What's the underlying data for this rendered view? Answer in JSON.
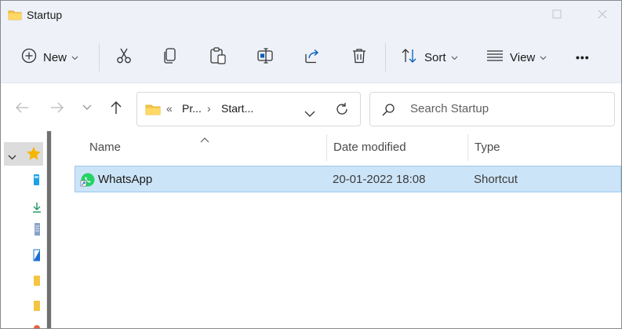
{
  "window": {
    "title": "Startup"
  },
  "toolbar": {
    "new_label": "New",
    "sort_label": "Sort",
    "view_label": "View",
    "more_label": "•••"
  },
  "address": {
    "overflow": "«",
    "crumbs": [
      "Pr...",
      "Start..."
    ]
  },
  "search": {
    "placeholder": "Search Startup"
  },
  "columns": {
    "name": "Name",
    "date": "Date modified",
    "type": "Type"
  },
  "files": [
    {
      "name": "WhatsApp",
      "date": "20-01-2022 18:08",
      "type": "Shortcut",
      "icon": "whatsapp-shortcut-icon"
    }
  ],
  "colors": {
    "selection": "#cce4f7",
    "selection_border": "#99c9ef",
    "accent": "#005fb8",
    "folder": "#f4c543"
  }
}
